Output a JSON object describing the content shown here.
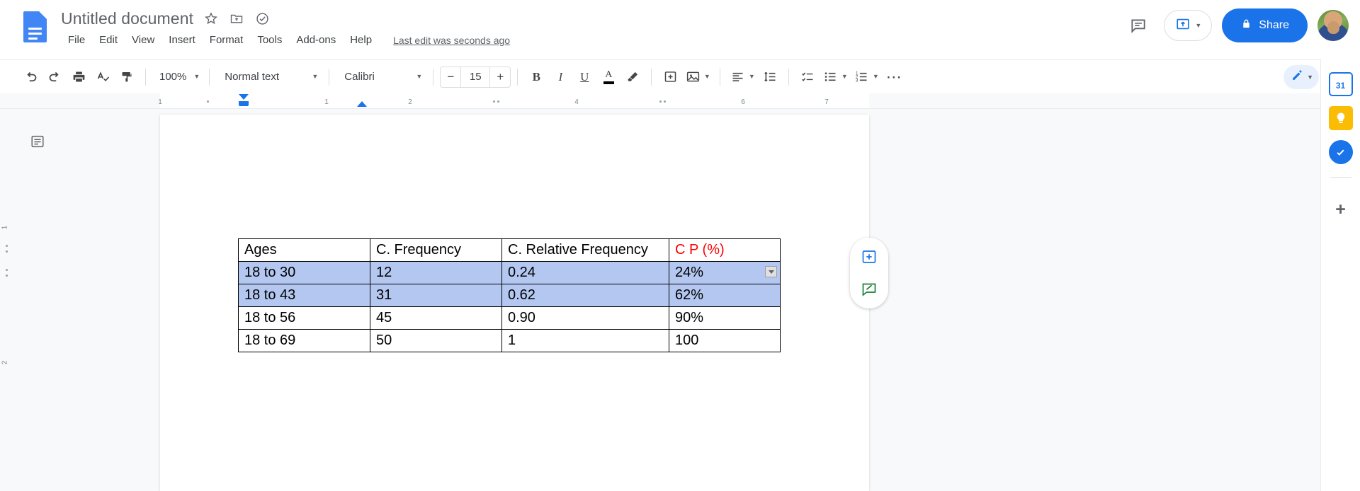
{
  "app": {
    "logo_icon": "google-docs-icon"
  },
  "header": {
    "doc_title": "Untitled document",
    "title_icons": [
      {
        "name": "star-icon",
        "glyph": "star"
      },
      {
        "name": "move-to-folder-icon",
        "glyph": "folder-move"
      },
      {
        "name": "cloud-saved-icon",
        "glyph": "cloud-check"
      }
    ],
    "menus": [
      "File",
      "Edit",
      "View",
      "Insert",
      "Format",
      "Tools",
      "Add-ons",
      "Help"
    ],
    "last_edit": "Last edit was seconds ago",
    "comment_history_icon": "comment-history-icon",
    "present_label": "",
    "share_label": "Share",
    "share_lock_icon": "lock-icon",
    "avatar_name": "user-avatar"
  },
  "toolbar": {
    "undo_icon": "undo-icon",
    "redo_icon": "redo-icon",
    "print_icon": "print-icon",
    "spelling_icon": "spellcheck-icon",
    "paint_format_icon": "paint-format-icon",
    "zoom_value": "100%",
    "style_value": "Normal text",
    "font_value": "Calibri",
    "font_size": "15",
    "decrease_font_label": "−",
    "increase_font_label": "+",
    "bold_label": "B",
    "italic_label": "I",
    "underline_label": "U",
    "text_color_label": "A",
    "highlight_icon": "highlight-pen-icon",
    "insert_link_icon": "insert-link-icon",
    "insert_image_icon": "insert-image-icon",
    "align_icon": "align-left-icon",
    "line_spacing_icon": "line-spacing-icon",
    "checklist_icon": "checklist-icon",
    "bulleted_list_icon": "bulleted-list-icon",
    "numbered_list_icon": "numbered-list-icon",
    "more_icon": "more-options-icon",
    "editing_mode_icon": "edit-pencil-icon",
    "collapse_icon": "collapse-toolbar-icon"
  },
  "ruler": {
    "ticks": [
      "1",
      "1",
      "2",
      "4",
      "6",
      "7"
    ],
    "vertical_ticks": [
      "1",
      "2"
    ]
  },
  "document": {
    "outline_icon": "document-outline-icon",
    "table": {
      "headers": [
        "Ages",
        "C. Frequency",
        "C. Relative Frequency",
        "C P (%)"
      ],
      "header_colors": [
        "#000000",
        "#000000",
        "#000000",
        "#ff0000"
      ],
      "rows": [
        {
          "cells": [
            "18 to 30",
            "12",
            "0.24",
            "24%"
          ],
          "selected": true
        },
        {
          "cells": [
            "18 to 43",
            "31",
            "0.62",
            "62%"
          ],
          "selected": true
        },
        {
          "cells": [
            "18 to 56",
            "45",
            "0.90",
            "90%"
          ],
          "selected": false
        },
        {
          "cells": [
            "18 to 69",
            "50",
            "1",
            "100"
          ],
          "selected": false
        }
      ],
      "selection_color": "#b4c7f0",
      "cell_dropdown_icon": "cell-options-dropdown-icon"
    }
  },
  "floating": {
    "add_comment_icon": "add-comment-icon",
    "suggest_edit_icon": "suggest-edit-icon"
  },
  "siderail": {
    "items": [
      {
        "name": "google-calendar-icon",
        "label": "31",
        "color": "#1a73e8"
      },
      {
        "name": "google-keep-icon",
        "label": "",
        "color": "#fbbc04"
      },
      {
        "name": "google-tasks-icon",
        "label": "",
        "color": "#1a73e8"
      },
      {
        "name": "add-ons-plus-icon",
        "label": "+",
        "color": "#5f6368"
      }
    ]
  },
  "scrollbar": {
    "name": "vertical-scrollbar"
  }
}
